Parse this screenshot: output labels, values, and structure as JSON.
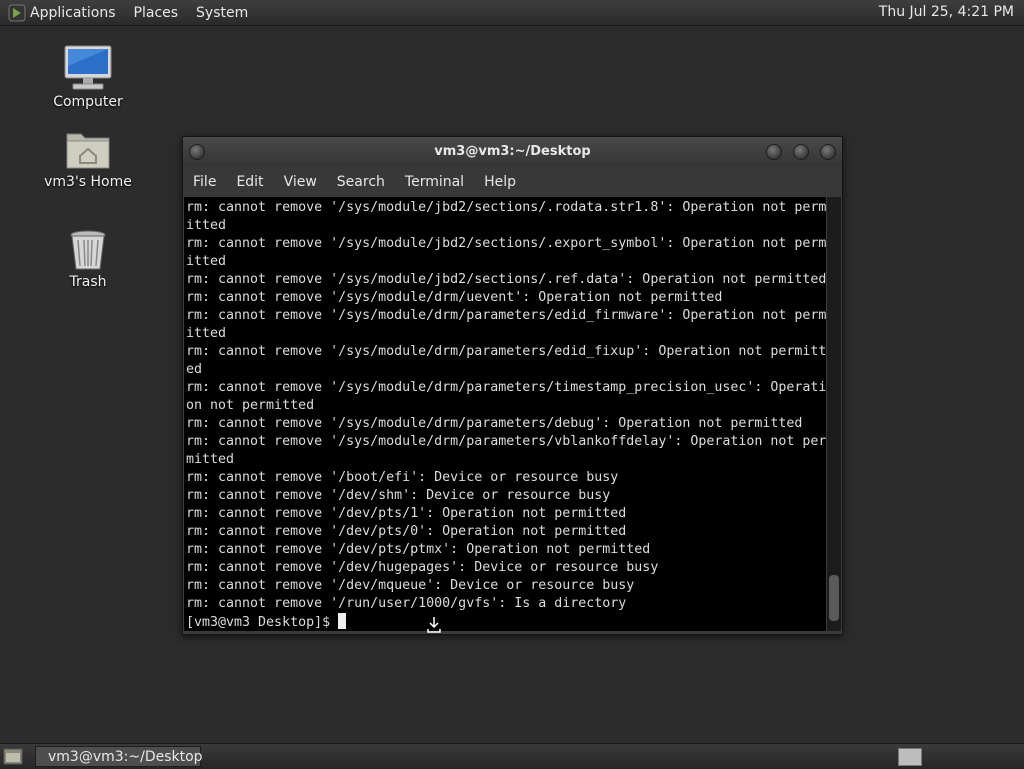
{
  "top_panel": {
    "menus": [
      "Applications",
      "Places",
      "System"
    ],
    "clock": "Thu Jul 25,  4:21 PM"
  },
  "desktop": {
    "icons": [
      {
        "label": "Computer",
        "icon": "computer-icon"
      },
      {
        "label": "vm3's Home",
        "icon": "home-folder-icon"
      },
      {
        "label": "Trash",
        "icon": "trash-icon"
      }
    ]
  },
  "terminal": {
    "title": "vm3@vm3:~/Desktop",
    "menus": [
      "File",
      "Edit",
      "View",
      "Search",
      "Terminal",
      "Help"
    ],
    "lines": [
      "rm: cannot remove '/sys/module/jbd2/sections/.rodata.str1.8': Operation not perm",
      "itted",
      "rm: cannot remove '/sys/module/jbd2/sections/.export_symbol': Operation not perm",
      "itted",
      "rm: cannot remove '/sys/module/jbd2/sections/.ref.data': Operation not permitted",
      "rm: cannot remove '/sys/module/drm/uevent': Operation not permitted",
      "rm: cannot remove '/sys/module/drm/parameters/edid_firmware': Operation not perm",
      "itted",
      "rm: cannot remove '/sys/module/drm/parameters/edid_fixup': Operation not permitt",
      "ed",
      "rm: cannot remove '/sys/module/drm/parameters/timestamp_precision_usec': Operati",
      "on not permitted",
      "rm: cannot remove '/sys/module/drm/parameters/debug': Operation not permitted",
      "rm: cannot remove '/sys/module/drm/parameters/vblankoffdelay': Operation not per",
      "mitted",
      "rm: cannot remove '/boot/efi': Device or resource busy",
      "rm: cannot remove '/dev/shm': Device or resource busy",
      "rm: cannot remove '/dev/pts/1': Operation not permitted",
      "rm: cannot remove '/dev/pts/0': Operation not permitted",
      "rm: cannot remove '/dev/pts/ptmx': Operation not permitted",
      "rm: cannot remove '/dev/hugepages': Device or resource busy",
      "rm: cannot remove '/dev/mqueue': Device or resource busy",
      "rm: cannot remove '/run/user/1000/gvfs': Is a directory"
    ],
    "prompt": "[vm3@vm3 Desktop]$ "
  },
  "taskbar": {
    "window_button": "vm3@vm3:~/Desktop"
  }
}
